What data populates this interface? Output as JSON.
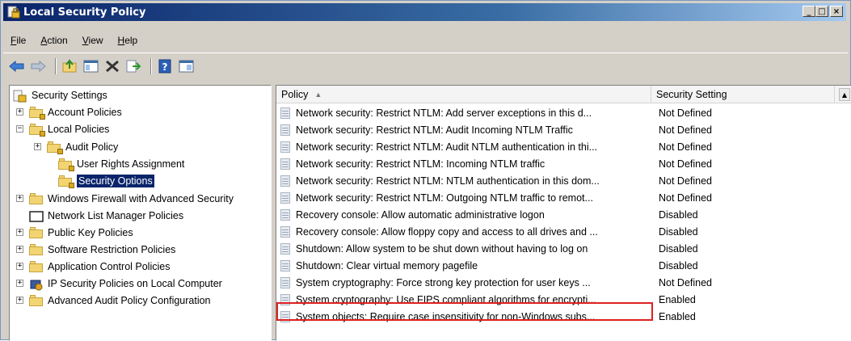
{
  "window": {
    "title": "Local Security Policy",
    "controls": {
      "minimize": "_",
      "maximize": "□",
      "close": "×"
    }
  },
  "menu": [
    {
      "label": "File",
      "accel": "F",
      "rest": "ile"
    },
    {
      "label": "Action",
      "accel": "A",
      "rest": "ction"
    },
    {
      "label": "View",
      "accel": "V",
      "rest": "iew"
    },
    {
      "label": "Help",
      "accel": "H",
      "rest": "elp"
    }
  ],
  "toolbar": {
    "icons": [
      "back-icon",
      "forward-icon",
      "up-folder-icon",
      "show-hide-tree-icon",
      "delete-icon",
      "export-list-icon",
      "help-icon",
      "properties-icon"
    ]
  },
  "tree": {
    "root": "Security Settings",
    "items": [
      {
        "label": "Account Policies"
      },
      {
        "label": "Local Policies"
      },
      {
        "label": "Audit Policy"
      },
      {
        "label": "User Rights Assignment"
      },
      {
        "label": "Security Options"
      },
      {
        "label": "Windows Firewall with Advanced Security"
      },
      {
        "label": "Network List Manager Policies"
      },
      {
        "label": "Public Key Policies"
      },
      {
        "label": "Software Restriction Policies"
      },
      {
        "label": "Application Control Policies"
      },
      {
        "label": "IP Security Policies on Local Computer"
      },
      {
        "label": "Advanced Audit Policy Configuration"
      }
    ],
    "selected": "Security Options"
  },
  "list": {
    "columns": {
      "policy": "Policy",
      "setting": "Security Setting"
    },
    "rows": [
      {
        "policy": "Network security: Restrict NTLM: Add server exceptions in this d...",
        "setting": "Not Defined"
      },
      {
        "policy": "Network security: Restrict NTLM: Audit Incoming NTLM Traffic",
        "setting": "Not Defined"
      },
      {
        "policy": "Network security: Restrict NTLM: Audit NTLM authentication in thi...",
        "setting": "Not Defined"
      },
      {
        "policy": "Network security: Restrict NTLM: Incoming NTLM traffic",
        "setting": "Not Defined"
      },
      {
        "policy": "Network security: Restrict NTLM: NTLM authentication in this dom...",
        "setting": "Not Defined"
      },
      {
        "policy": "Network security: Restrict NTLM: Outgoing NTLM traffic to remot...",
        "setting": "Not Defined"
      },
      {
        "policy": "Recovery console: Allow automatic administrative logon",
        "setting": "Disabled"
      },
      {
        "policy": "Recovery console: Allow floppy copy and access to all drives and ...",
        "setting": "Disabled"
      },
      {
        "policy": "Shutdown: Allow system to be shut down without having to log on",
        "setting": "Disabled"
      },
      {
        "policy": "Shutdown: Clear virtual memory pagefile",
        "setting": "Disabled"
      },
      {
        "policy": "System cryptography: Force strong key protection for user keys ...",
        "setting": "Not Defined"
      },
      {
        "policy": "System cryptography: Use FIPS compliant algorithms for encrypti...",
        "setting": "Enabled"
      },
      {
        "policy": "System objects: Require case insensitivity for non-Windows subs...",
        "setting": "Enabled"
      }
    ]
  },
  "colors": {
    "title_bar": "#0a246a",
    "highlight_border": "#e02020",
    "selection": "#0a246a"
  }
}
